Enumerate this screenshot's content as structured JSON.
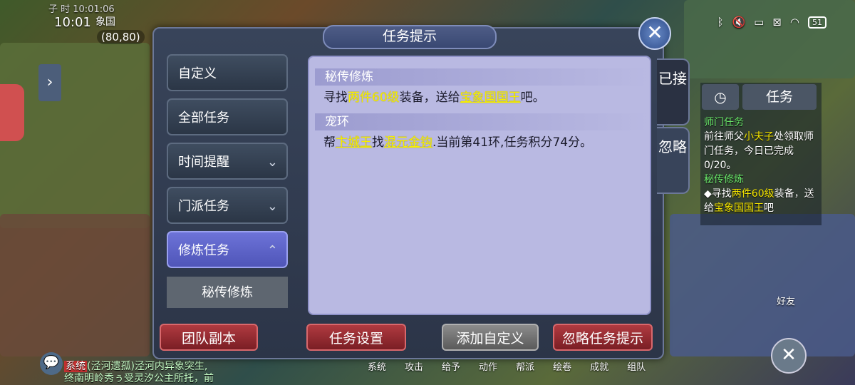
{
  "status_bar": {
    "top_label": "子 时  10:01:06",
    "time": "10:01",
    "location": "象国",
    "coords": "(80,80)",
    "battery": "51"
  },
  "dialog": {
    "title": "任务提示",
    "close_icon": "close-icon",
    "nav": [
      {
        "label": "自定义"
      },
      {
        "label": "全部任务"
      },
      {
        "label": "时间提醒",
        "chevron": "⌄"
      },
      {
        "label": "门派任务",
        "chevron": "⌄"
      },
      {
        "label": "修炼任务",
        "chevron": "⌃"
      }
    ],
    "nav_sub": "秘传修炼",
    "quests": [
      {
        "title": "秘传修炼",
        "desc": {
          "p1": "寻找",
          "h1": "两件60级",
          "p2": "装备，送给",
          "h2": "宝象国国王",
          "p3": "吧。"
        }
      },
      {
        "title": "宠环",
        "desc": {
          "p1": "帮",
          "h1": "卞城王",
          "p2": "找",
          "h2": "混元金钩",
          "p3": ".当前第41环,任务积分74分。"
        }
      }
    ],
    "side_tabs": {
      "accepted": "已接",
      "ignore": "忽略"
    },
    "buttons": {
      "team": "团队副本",
      "settings": "任务设置",
      "add_custom": "添加自定义",
      "ignore_tip": "忽略任务提示"
    }
  },
  "tracker": {
    "task_tab": "任务",
    "items": [
      {
        "head": "师门任务",
        "line1": "前往师父",
        "who": "小夫子",
        "line2": "处领取师门任务，今日已完成0/20。"
      },
      {
        "head": "秘传修炼",
        "line1": "◆寻找",
        "y1": "两件60级",
        "line2": "装备，送给",
        "y2": "宝象国国王",
        "line3": "吧"
      }
    ]
  },
  "bottom_chat": {
    "tag": "系统",
    "line1": "(泾河遗孤)泾河内异象突生,",
    "line2": "终南明岭秀ぅ受灵汐公主所托，前"
  },
  "bottom_menu": [
    "系统",
    "攻击",
    "给予",
    "动作",
    "帮派",
    "绘卷",
    "成就",
    "组队"
  ],
  "friend_label": "好友",
  "colors": {
    "highlight": "#f8f000",
    "active_nav": "#5c62c8",
    "content_bg": "#b9b9e2"
  }
}
